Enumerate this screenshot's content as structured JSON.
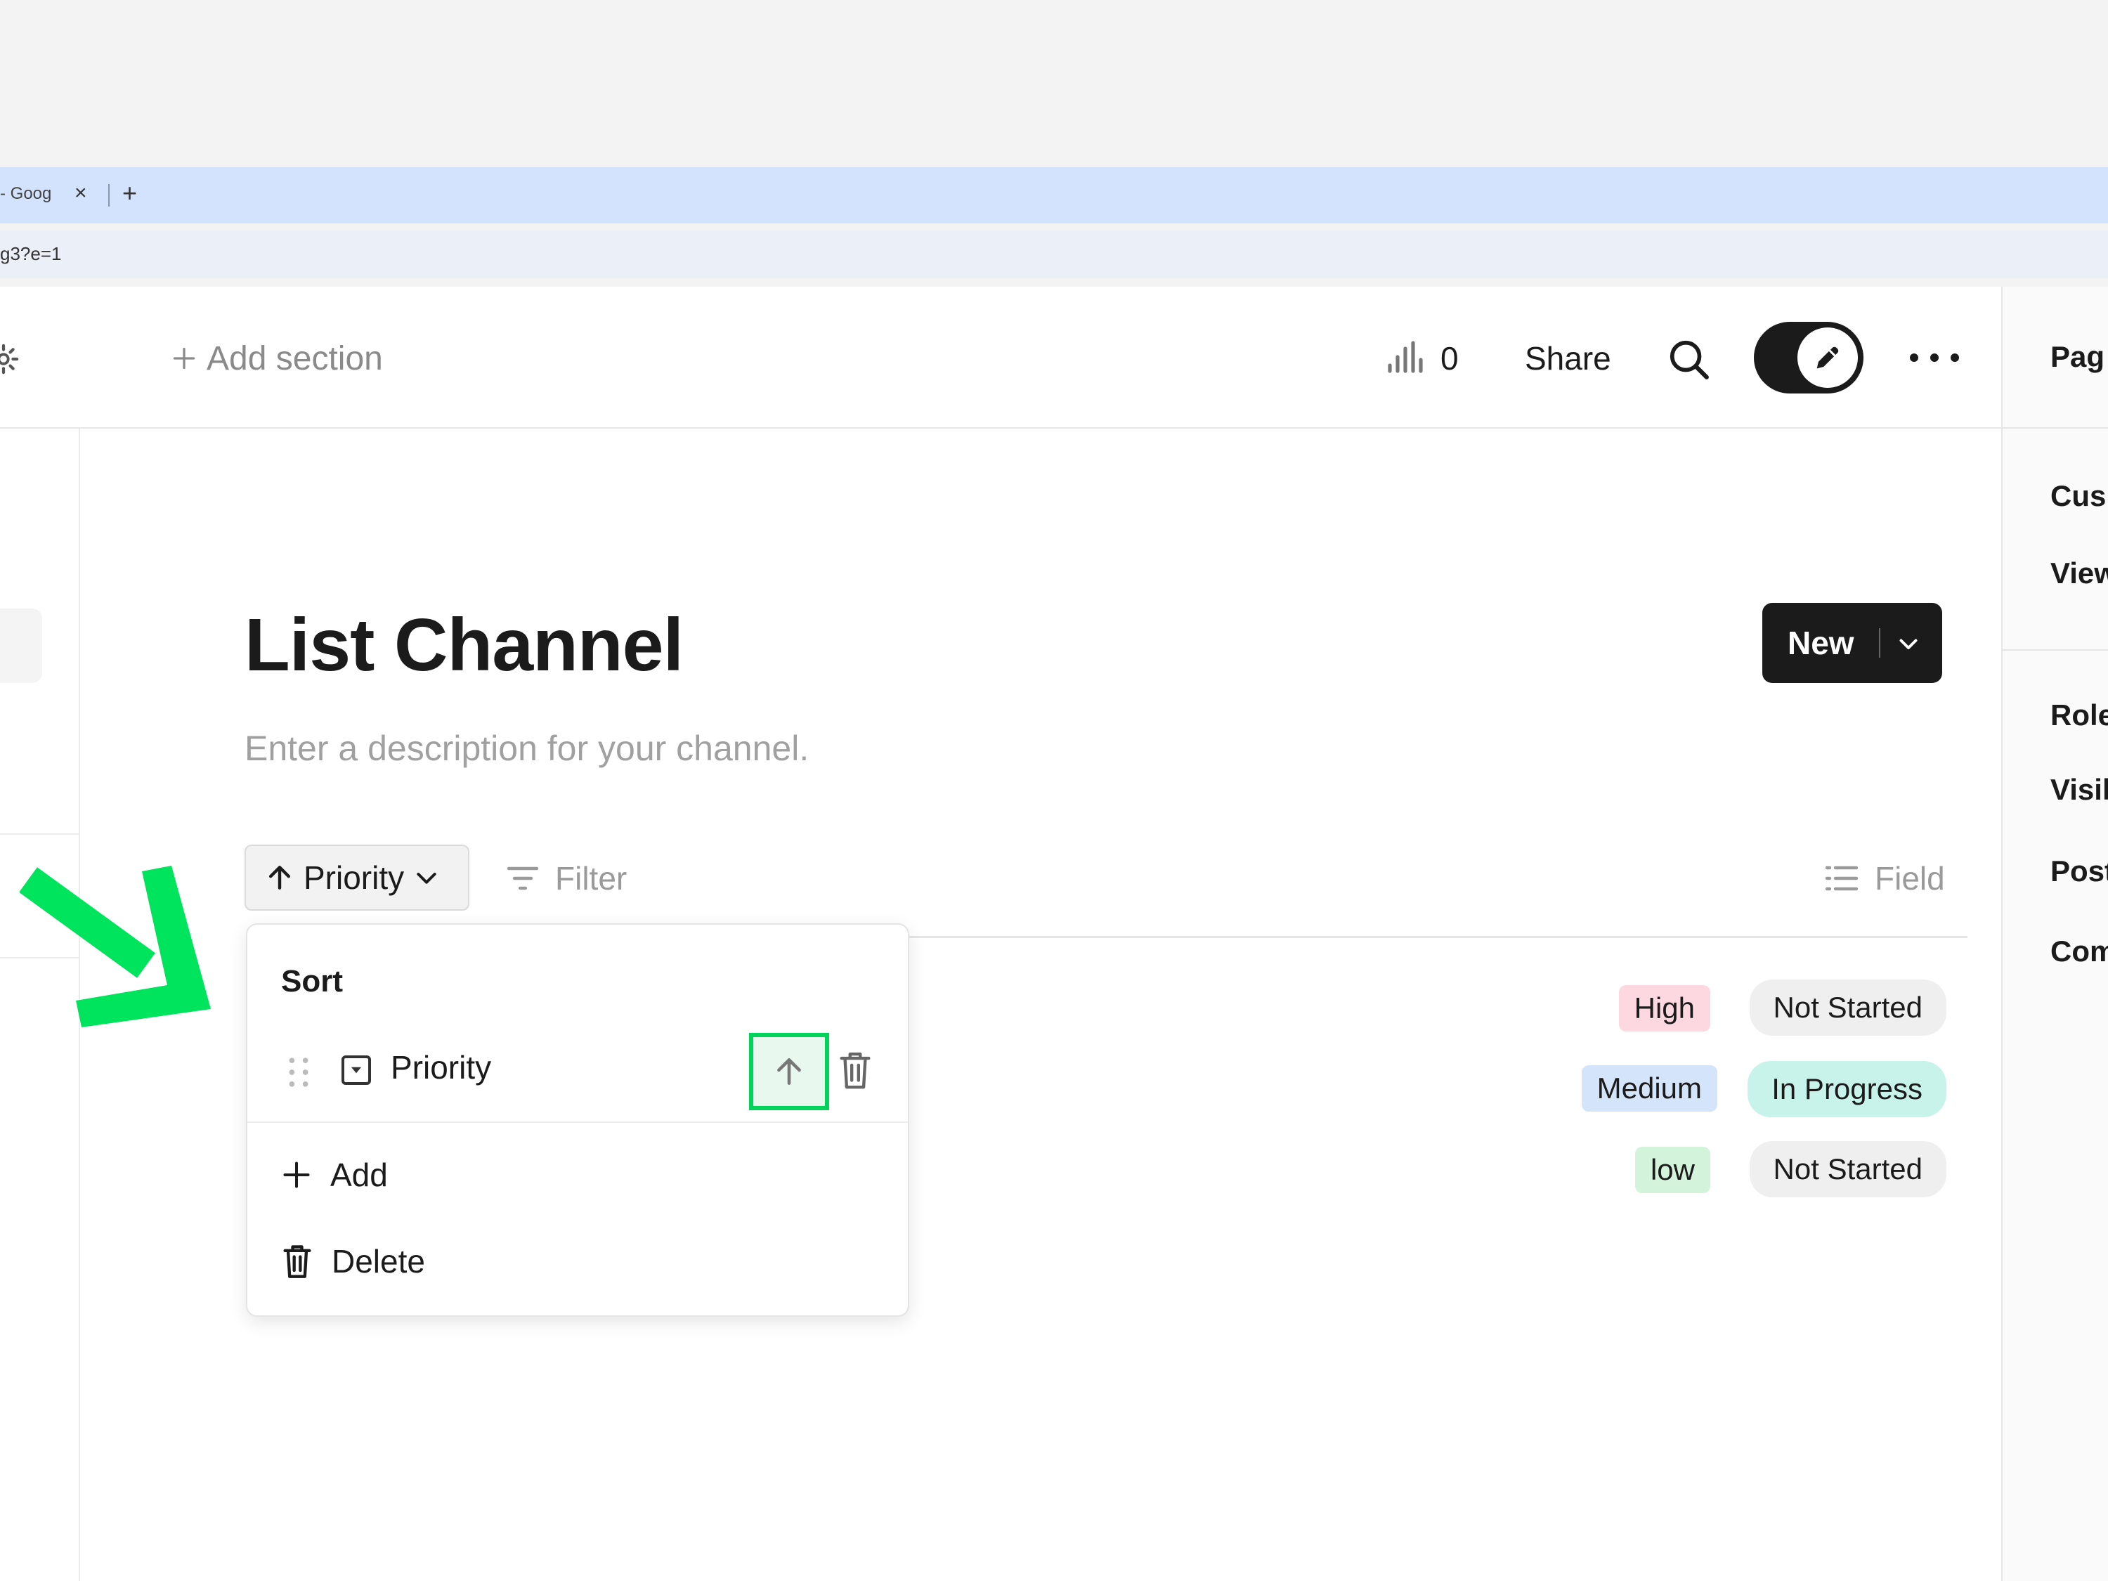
{
  "browser": {
    "tab_title": "- Goog",
    "tab_close": "×",
    "new_tab": "+",
    "url": "g3?e=1"
  },
  "topbar": {
    "add_section": "Add section",
    "stats_count": "0",
    "share": "Share"
  },
  "page": {
    "title": "List Channel",
    "description": "Enter a description for your channel."
  },
  "new_button": {
    "label": "New"
  },
  "toolbar": {
    "sort_label": "Priority",
    "filter": "Filter",
    "field": "Field"
  },
  "rows": [
    {
      "priority": "High",
      "priority_color": "#fdd8e0",
      "status": "Not Started",
      "status_color": "#efefef"
    },
    {
      "priority": "Medium",
      "priority_color": "#d4e4fb",
      "status": "In Progress",
      "status_color": "#c8f3ea"
    },
    {
      "priority": "low",
      "priority_color": "#d3f4da",
      "status": "Not Started",
      "status_color": "#efefef"
    }
  ],
  "sort_popover": {
    "heading": "Sort",
    "field": "Priority",
    "add": "Add",
    "delete": "Delete"
  },
  "right_panel": {
    "items": [
      "Pag",
      "Cus",
      "View",
      "Role",
      "Visil",
      "Post",
      "Com"
    ]
  },
  "colors": {
    "highlight": "#00d35a",
    "accent_dark": "#1b1b1b"
  }
}
